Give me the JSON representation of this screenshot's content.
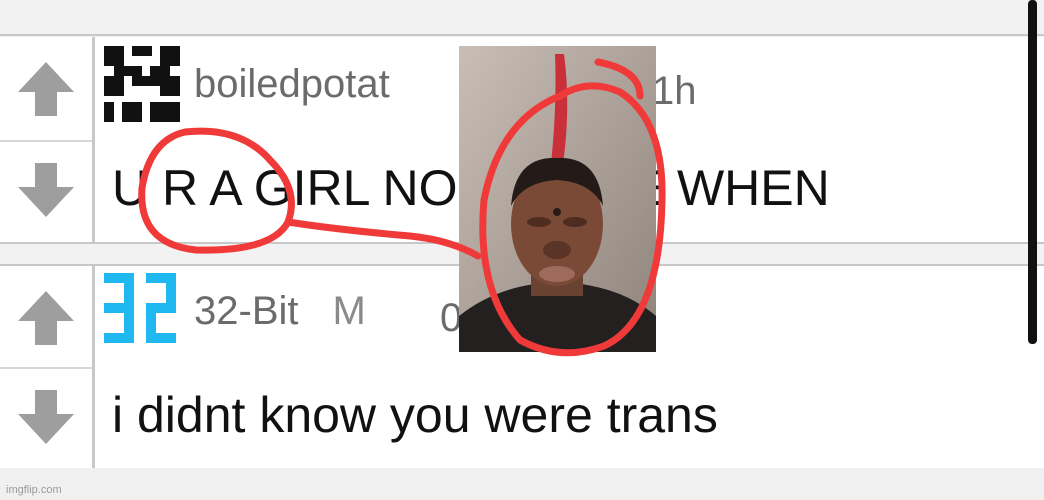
{
  "comments": [
    {
      "username": "boiledpotat",
      "moderator_badge": "",
      "time": "1h",
      "body": "U R A GIRL NO ONE CE WHEN"
    },
    {
      "username": "32-Bit",
      "moderator_badge": "M",
      "time": "0",
      "body": "i didnt know you were trans"
    }
  ],
  "overlay_photo": {
    "description": "",
    "mark_color": "#f03a3a"
  },
  "watermark": "imgflip.com",
  "colors": {
    "vote_arrow": "#9e9e9e",
    "avatar_dark": "#111111",
    "avatar_blue": "#1fb8f0",
    "accent": "#29b6e8"
  }
}
